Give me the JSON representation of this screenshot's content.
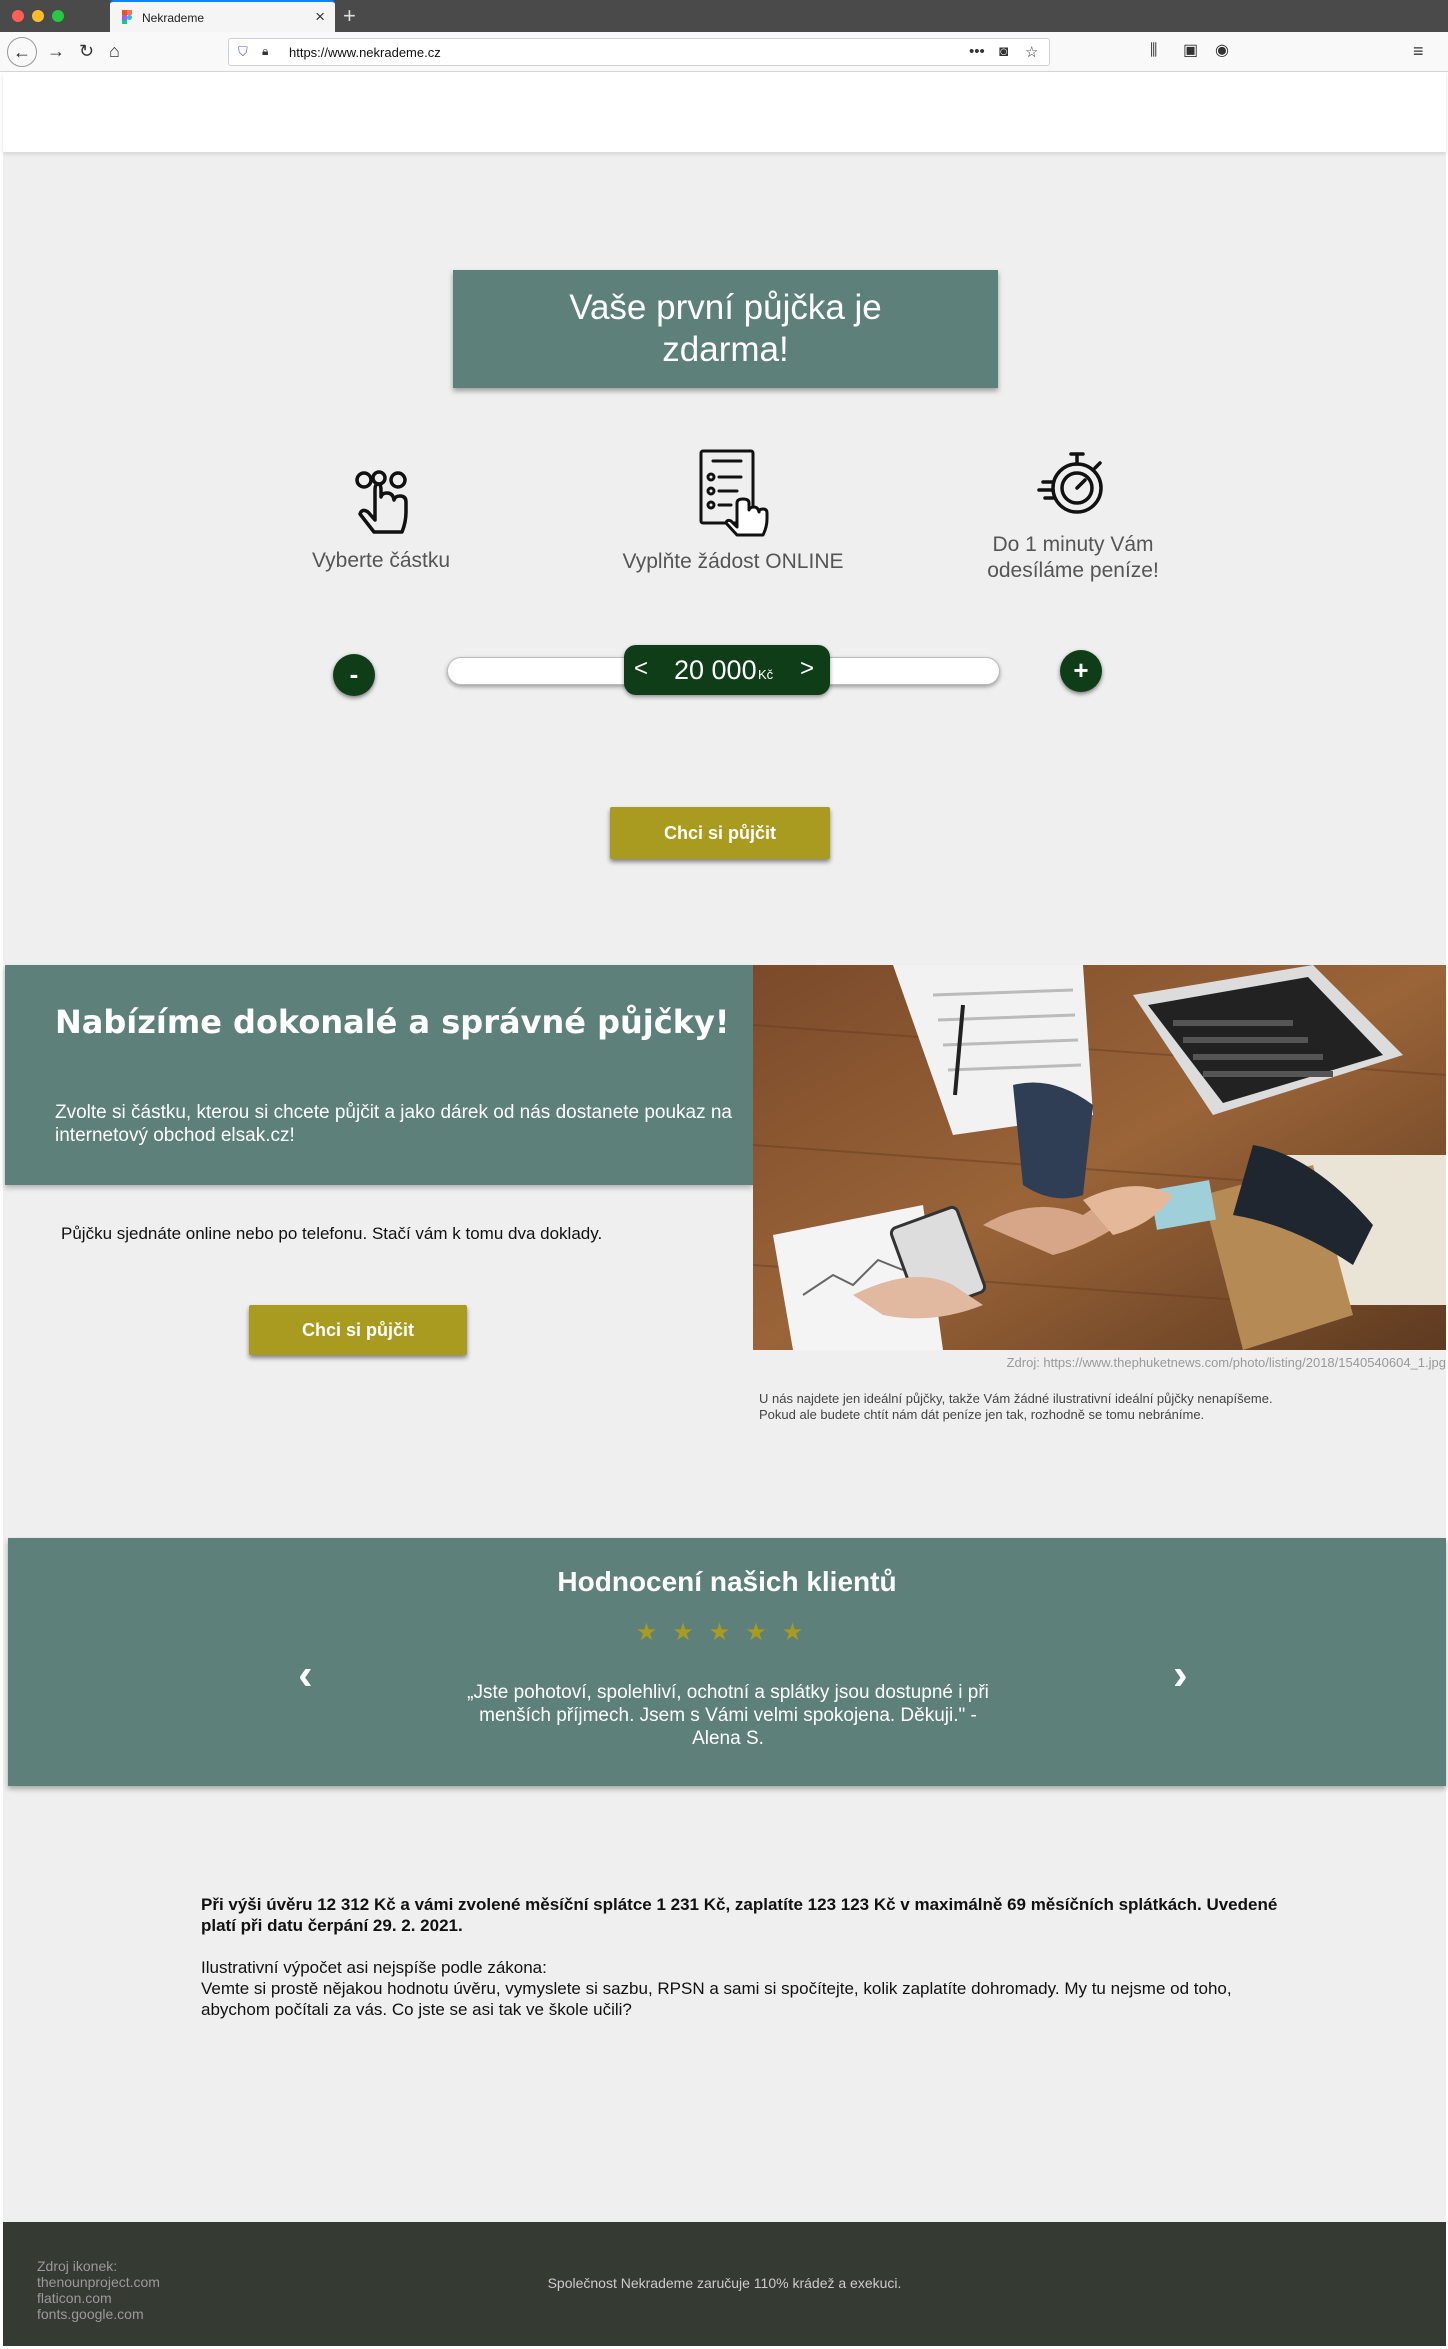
{
  "browser": {
    "tab_title": "Nekrademe",
    "url": "https://www.nekrademe.cz"
  },
  "hero": {
    "title": "Vaše první půjčka je zdarma!"
  },
  "steps": [
    {
      "label": "Vyberte částku",
      "icon": "tap-finger-icon"
    },
    {
      "label": "Vyplňte žádost ONLINE",
      "icon": "form-checklist-icon"
    },
    {
      "label": "Do 1 minuty Vám odesíláme peníze!",
      "icon": "stopwatch-icon"
    }
  ],
  "slider": {
    "minus_label": "-",
    "plus_label": "+",
    "left_arrow": "<",
    "right_arrow": ">",
    "amount": "20 000",
    "currency": "Kč"
  },
  "cta": {
    "label": "Chci si půjčit"
  },
  "offer": {
    "heading": "Nabízíme dokonalé a správné půjčky!",
    "text": "Zvolte si částku, kterou si chcete půjčit a jako dárek od nás dostanete poukaz na internetový obchod elsak.cz!",
    "subtext": "Půjčku sjednáte online nebo po telefonu. Stačí vám k tomu dva doklady.",
    "button": "Chci si půjčit",
    "photo_source": "Zdroj: https://www.thephuketnews.com/photo/listing/2018/1540540604_1.jpg",
    "photo_note": "U nás najdete jen ideální půjčky, takže Vám žádné ilustrativní ideální půjčky nenapíšeme. Pokud ale budete chtít nám dát peníze jen tak, rozhodně se tomu nebráníme."
  },
  "reviews": {
    "heading": "Hodnocení našich klientů",
    "stars": "★★★★★",
    "rating": 5,
    "quote": "„Jste pohotoví, spolehliví, ochotní a splátky jsou dostupné i při menších příjmech. Jsem s Vámi velmi spokojena. Děkuji.\" - Alena S.",
    "prev": "‹",
    "next": "›"
  },
  "disclaimer": {
    "strong": "Při výši úvěru 12 312 Kč a vámi zvolené měsíční splátce 1 231 Kč, zaplatíte 123 123 Kč v maximálně 69 měsíčních splátkách. Uvedené platí při datu čerpání 29. 2. 2021.",
    "line1": "Ilustrativní výpočet asi nejspíše podle zákona:",
    "line2": "Vemte si prostě nějakou hodnotu úvěru, vymyslete si sazbu, RPSN a sami si spočítejte, kolik zaplatíte dohromady. My tu nejsme od toho, abychom počítali za vás. Co jste se asi tak ve škole učili?"
  },
  "footer": {
    "sources_title": "Zdroj ikonek:",
    "sources": [
      "thenounproject.com",
      "flaticon.com",
      "fonts.google.com"
    ],
    "note": "Společnost Nekrademe zaručuje 110% krádež a exekuci."
  },
  "colors": {
    "teal": "#5e807b",
    "dark_green": "#0f3d17",
    "gold": "#a89b1f",
    "footer": "#353a33"
  }
}
